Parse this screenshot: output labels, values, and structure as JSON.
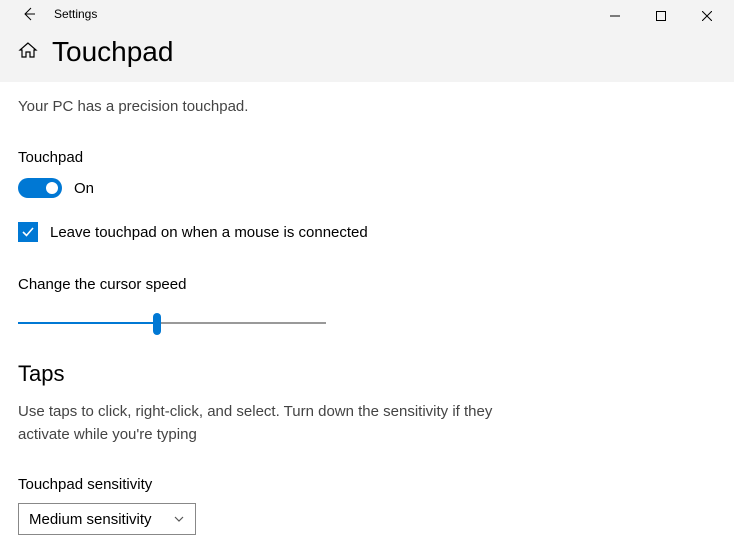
{
  "titlebar": {
    "app_name": "Settings"
  },
  "header": {
    "page_title": "Touchpad"
  },
  "touchpad": {
    "description": "Your PC has a precision touchpad.",
    "section_label": "Touchpad",
    "toggle_state": "On",
    "checkbox_label": "Leave touchpad on when a mouse is connected",
    "cursor_speed_label": "Change the cursor speed"
  },
  "taps": {
    "heading": "Taps",
    "description": "Use taps to click, right-click, and select. Turn down the sensitivity if they activate while you're typing",
    "sensitivity_label": "Touchpad sensitivity",
    "sensitivity_value": "Medium sensitivity"
  }
}
